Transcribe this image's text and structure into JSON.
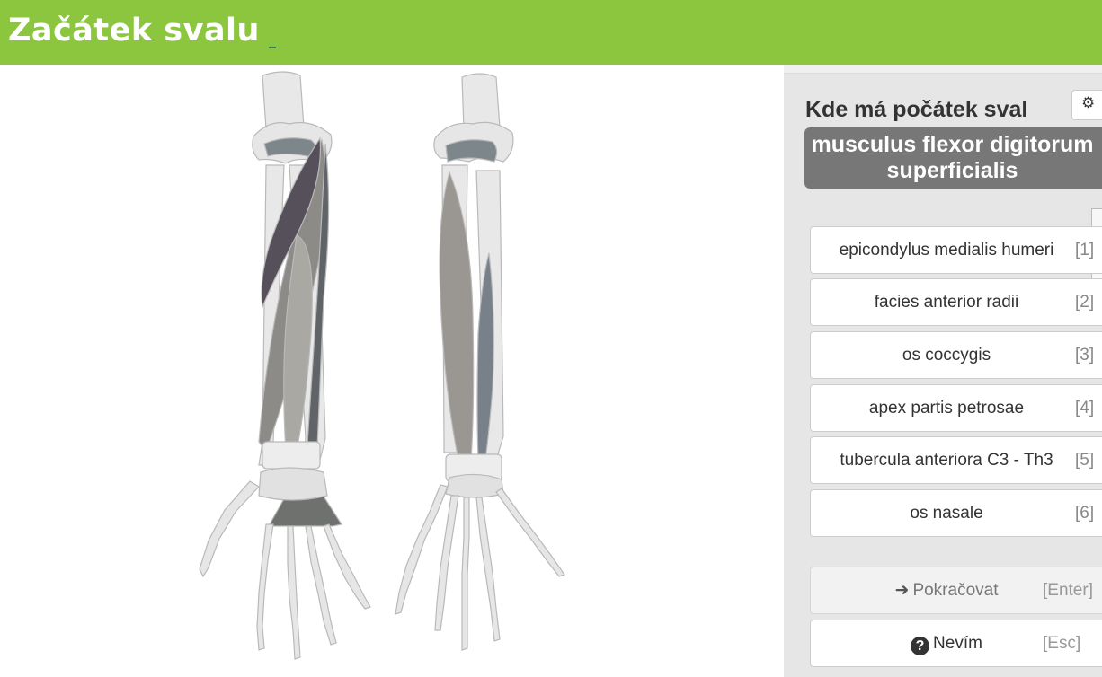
{
  "header": {
    "title": "Začátek svalu"
  },
  "panel": {
    "question": "Kde má počátek sval",
    "term": "musculus flexor digitorum superficialis",
    "settings_icon": "gear-icon",
    "options": [
      {
        "label": "epicondylus medialis humeri",
        "key": "[1]"
      },
      {
        "label": "facies anterior radii",
        "key": "[2]"
      },
      {
        "label": "os coccygis",
        "key": "[3]"
      },
      {
        "label": "apex partis petrosae",
        "key": "[4]"
      },
      {
        "label": "tubercula anteriora C3 - Th3",
        "key": "[5]"
      },
      {
        "label": "os nasale",
        "key": "[6]"
      }
    ],
    "continue": {
      "label": "Pokračovat",
      "key": "[Enter]",
      "icon": "arrow-right-icon"
    },
    "dont_know": {
      "label": "Nevím",
      "key": "[Esc]",
      "icon": "question-circle-icon"
    }
  },
  "colors": {
    "header_bg": "#8cc63f",
    "panel_bg": "#e6e6e6",
    "term_bg": "#777777",
    "bone": "#e6e6e6",
    "muscle_dark": "#5a5560",
    "muscle_mid": "#8c8a84"
  }
}
